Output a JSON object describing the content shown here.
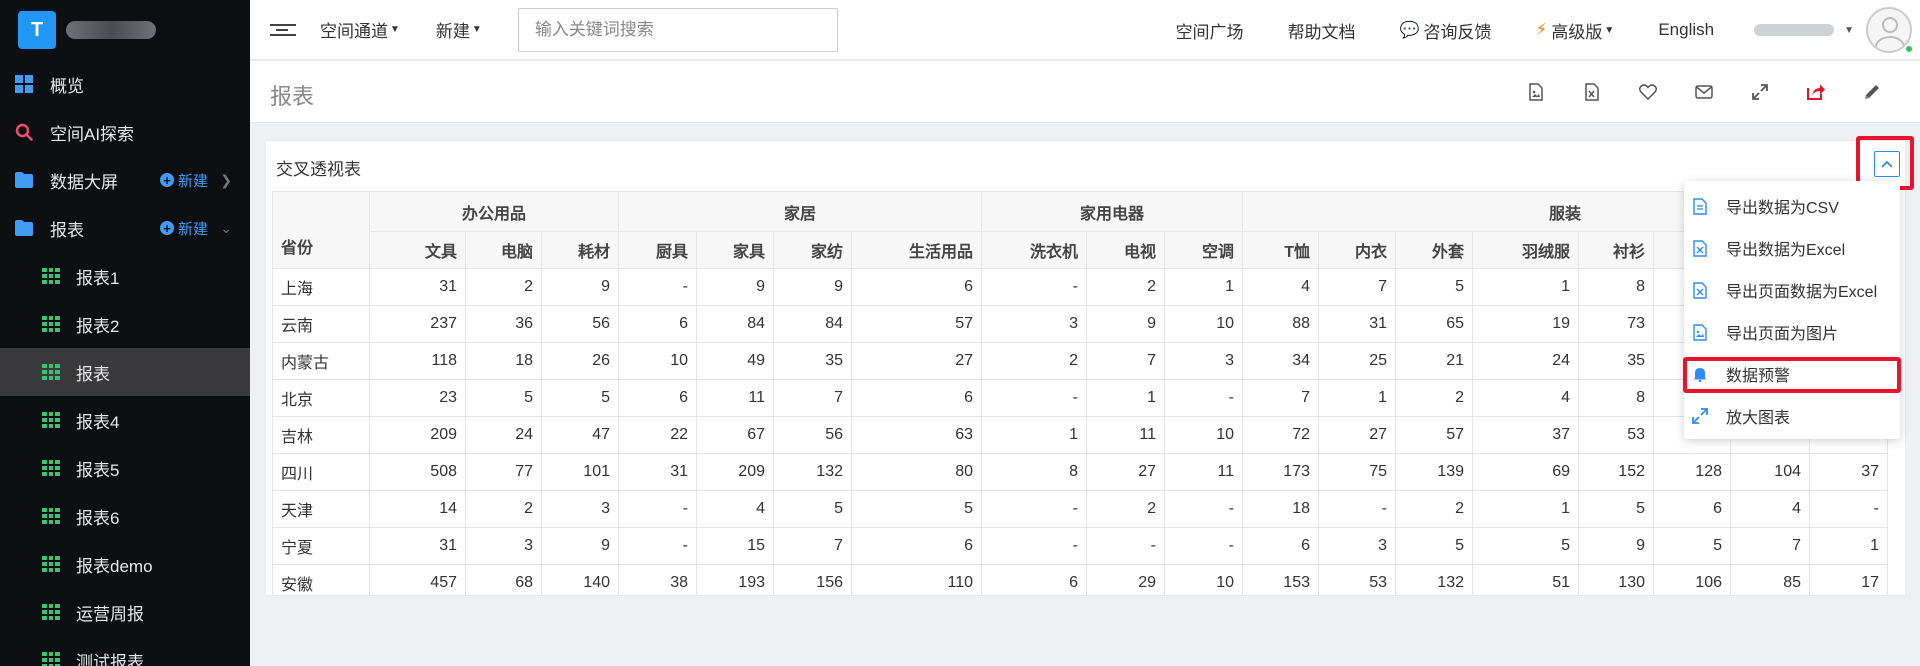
{
  "brand": {
    "logo_letter": "T"
  },
  "sidebar": {
    "items": [
      {
        "label": "概览",
        "icon": "dashboard-icon"
      },
      {
        "label": "空间AI探索",
        "icon": "search-icon"
      },
      {
        "label": "数据大屏",
        "icon": "folder-icon",
        "new_label": "新建"
      },
      {
        "label": "报表",
        "icon": "folder-icon",
        "new_label": "新建"
      }
    ],
    "sub_items": [
      "报表1",
      "报表2",
      "报表",
      "报表4",
      "报表5",
      "报表6",
      "报表demo",
      "运营周报",
      "测试报表"
    ]
  },
  "topbar": {
    "channel": "空间通道",
    "new": "新建",
    "search_placeholder": "输入关键词搜索",
    "plaza": "空间广场",
    "help": "帮助文档",
    "feedback": "咨询反馈",
    "advanced": "高级版",
    "language": "English"
  },
  "page": {
    "title": "报表"
  },
  "card": {
    "title": "交叉透视表"
  },
  "table": {
    "row_header": "省份",
    "groups": [
      {
        "label": "办公用品",
        "columns": [
          "文具",
          "电脑",
          "耗材"
        ]
      },
      {
        "label": "家居",
        "columns": [
          "厨具",
          "家具",
          "家纺",
          "生活用品"
        ]
      },
      {
        "label": "家用电器",
        "columns": [
          "洗衣机",
          "电视",
          "空调"
        ]
      },
      {
        "label": "服装",
        "columns": [
          "T恤",
          "内衣",
          "外套",
          "羽绒服",
          "衬衫",
          "",
          "",
          ""
        ]
      }
    ],
    "rows": [
      {
        "province": "上海",
        "values": [
          "31",
          "2",
          "9",
          "-",
          "9",
          "9",
          "6",
          "-",
          "2",
          "1",
          "4",
          "7",
          "5",
          "1",
          "8",
          "",
          "",
          ""
        ]
      },
      {
        "province": "云南",
        "values": [
          "237",
          "36",
          "56",
          "6",
          "84",
          "84",
          "57",
          "3",
          "9",
          "10",
          "88",
          "31",
          "65",
          "19",
          "73",
          "",
          "",
          ""
        ]
      },
      {
        "province": "内蒙古",
        "values": [
          "118",
          "18",
          "26",
          "10",
          "49",
          "35",
          "27",
          "2",
          "7",
          "3",
          "34",
          "25",
          "21",
          "24",
          "35",
          "",
          "",
          ""
        ]
      },
      {
        "province": "北京",
        "values": [
          "23",
          "5",
          "5",
          "6",
          "11",
          "7",
          "6",
          "-",
          "1",
          "-",
          "7",
          "1",
          "2",
          "4",
          "8",
          "",
          "",
          ""
        ]
      },
      {
        "province": "吉林",
        "values": [
          "209",
          "24",
          "47",
          "22",
          "67",
          "56",
          "63",
          "1",
          "11",
          "10",
          "72",
          "27",
          "57",
          "37",
          "53",
          "",
          "",
          ""
        ]
      },
      {
        "province": "四川",
        "values": [
          "508",
          "77",
          "101",
          "31",
          "209",
          "132",
          "80",
          "8",
          "27",
          "11",
          "173",
          "75",
          "139",
          "69",
          "152",
          "128",
          "104",
          "37"
        ]
      },
      {
        "province": "天津",
        "values": [
          "14",
          "2",
          "3",
          "-",
          "4",
          "5",
          "5",
          "-",
          "2",
          "-",
          "18",
          "-",
          "2",
          "1",
          "5",
          "6",
          "4",
          "-"
        ]
      },
      {
        "province": "宁夏",
        "values": [
          "31",
          "3",
          "9",
          "-",
          "15",
          "7",
          "6",
          "-",
          "-",
          "-",
          "6",
          "3",
          "5",
          "5",
          "9",
          "5",
          "7",
          "1"
        ]
      },
      {
        "province": "安徽",
        "values": [
          "457",
          "68",
          "140",
          "38",
          "193",
          "156",
          "110",
          "6",
          "29",
          "10",
          "153",
          "53",
          "132",
          "51",
          "130",
          "106",
          "85",
          "17"
        ]
      }
    ]
  },
  "dropdown": {
    "items": [
      {
        "label": "导出数据为CSV",
        "icon": "csv-file-icon"
      },
      {
        "label": "导出数据为Excel",
        "icon": "excel-file-icon"
      },
      {
        "label": "导出页面数据为Excel",
        "icon": "excel-file-icon"
      },
      {
        "label": "导出页面为图片",
        "icon": "image-file-icon"
      },
      {
        "label": "数据预警",
        "icon": "bell-icon"
      },
      {
        "label": "放大图表",
        "icon": "expand-icon"
      }
    ]
  },
  "colors": {
    "sidebar_bg": "#0e0f12",
    "accent_blue": "#2d8cf0",
    "highlight_red": "#e8132c",
    "table_icon_green": "#36c46f"
  }
}
